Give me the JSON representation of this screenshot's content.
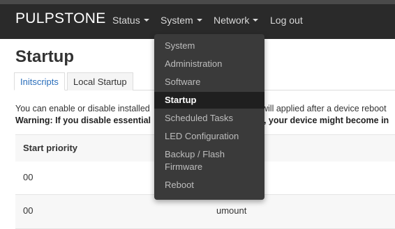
{
  "navbar": {
    "brand": "PULPSTONE",
    "items": [
      {
        "label": "Status",
        "has_caret": true
      },
      {
        "label": "System",
        "has_caret": true
      },
      {
        "label": "Network",
        "has_caret": true
      },
      {
        "label": "Log out",
        "has_caret": false
      }
    ]
  },
  "dropdown": {
    "items": [
      {
        "label": "System"
      },
      {
        "label": "Administration"
      },
      {
        "label": "Software"
      },
      {
        "label": "Startup",
        "active": true
      },
      {
        "label": "Scheduled Tasks"
      },
      {
        "label": "LED Configuration"
      },
      {
        "label": "Backup / Flash Firmware"
      },
      {
        "label": "Reboot"
      }
    ]
  },
  "page": {
    "title": "Startup",
    "tabs": [
      {
        "label": "Initscripts",
        "active": true
      },
      {
        "label": "Local Startup",
        "active": false
      }
    ],
    "description_line1_left": "You can enable or disable installed",
    "description_line1_right": "will applied after a device reboot",
    "warning_left": "Warning: If you disable essential",
    "warning_right": "', your device might become in"
  },
  "table": {
    "header_start_priority": "Start priority",
    "rows": [
      {
        "priority": "00",
        "name": ""
      },
      {
        "priority": "00",
        "name": "umount"
      }
    ]
  },
  "colors": {
    "navbar_bg": "#2a2a2a",
    "dropdown_bg": "#3a3a3a",
    "active_tab_text": "#2a6ebb"
  }
}
